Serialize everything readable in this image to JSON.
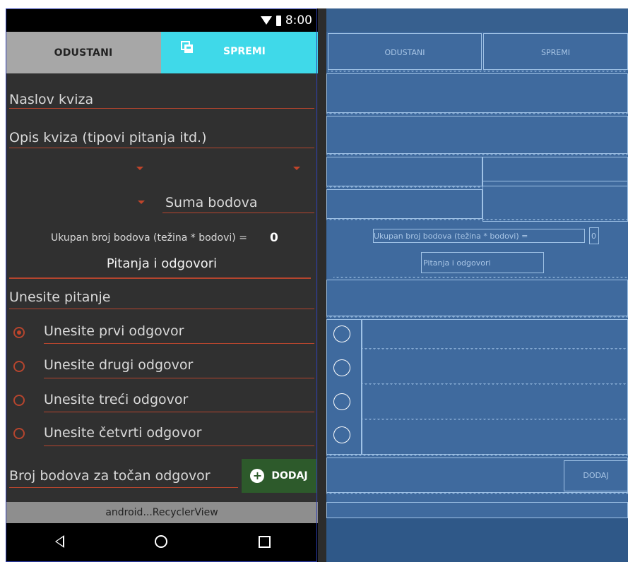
{
  "status_bar": {
    "time": "8:00"
  },
  "toolbar": {
    "cancel_label": "ODUSTANI",
    "save_label": "SPREMI"
  },
  "form": {
    "quiz_title_hint": "Naslov kviza",
    "quiz_description_hint": "Opis kviza (tipovi pitanja itd.)",
    "points_sum_hint": "Suma bodova",
    "total_points_label": "Ukupan broj bodova (težina * bodovi) =",
    "total_points_value": "0",
    "qa_section_title": "Pitanja i odgovori",
    "question_hint": "Unesite pitanje",
    "answers": [
      {
        "hint": "Unesite prvi odgovor",
        "checked": true
      },
      {
        "hint": "Unesite drugi odgovor",
        "checked": false
      },
      {
        "hint": "Unesite treći odgovor",
        "checked": false
      },
      {
        "hint": "Unesite četvrti odgovor",
        "checked": false
      }
    ],
    "correct_points_hint": "Broj bodova za točan odgovor",
    "add_label": "DODAJ"
  },
  "recycler_label": "android...RecyclerView",
  "blueprint": {
    "cancel_label": "ODUSTANI",
    "save_label": "SPREMI",
    "total_points_label": "Ukupan broj bodova (težina * bodovi) =",
    "total_points_value": "0",
    "qa_section_title": "Pitanja i odgovori",
    "add_label": "DODAJ"
  },
  "colors": {
    "background_dark": "#303030",
    "accent_red": "#c0442a",
    "cancel_gray": "#a7a7a7",
    "save_cyan": "#3fd9e9",
    "add_green": "#2d5a2b",
    "blueprint_blue": "#3f6a9e"
  },
  "icons": {
    "wifi": "wifi-icon",
    "battery": "battery-icon",
    "save": "save-icon",
    "add": "add-circle-icon",
    "back": "nav-back-icon",
    "home": "nav-home-icon",
    "recent": "nav-recent-icon"
  }
}
